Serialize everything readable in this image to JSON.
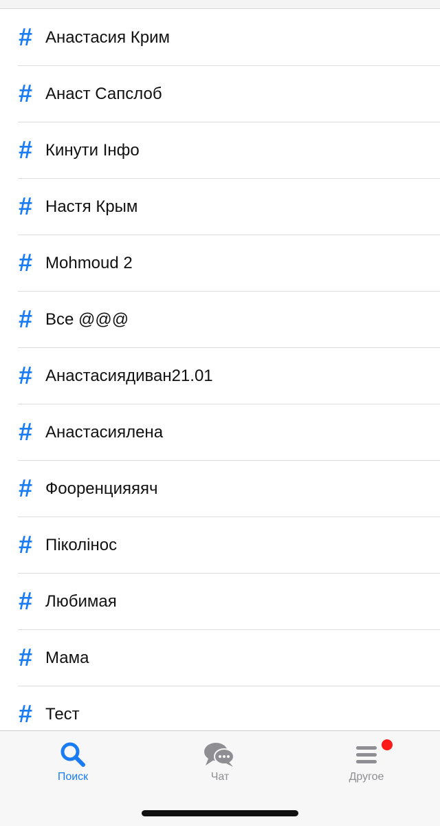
{
  "tags": [
    "Анастасия Крим",
    "Анаст Сапслоб",
    "Кинути Інфо",
    "Настя Крым",
    "Mohmoud 2",
    "Все @@@",
    "Анастасиядиван21.01",
    "Анастасиялена",
    "Фооренцияяяч",
    "Піколінос",
    "Любимая",
    "Мама",
    "Тест"
  ],
  "row_icon": "hashtag-icon",
  "row_icon_glyph": "#",
  "accent_color": "#1a7cf5",
  "tabbar": {
    "search_label": "Поиск",
    "chat_label": "Чат",
    "other_label": "Другое",
    "active_tab": "search",
    "other_badge": true
  }
}
